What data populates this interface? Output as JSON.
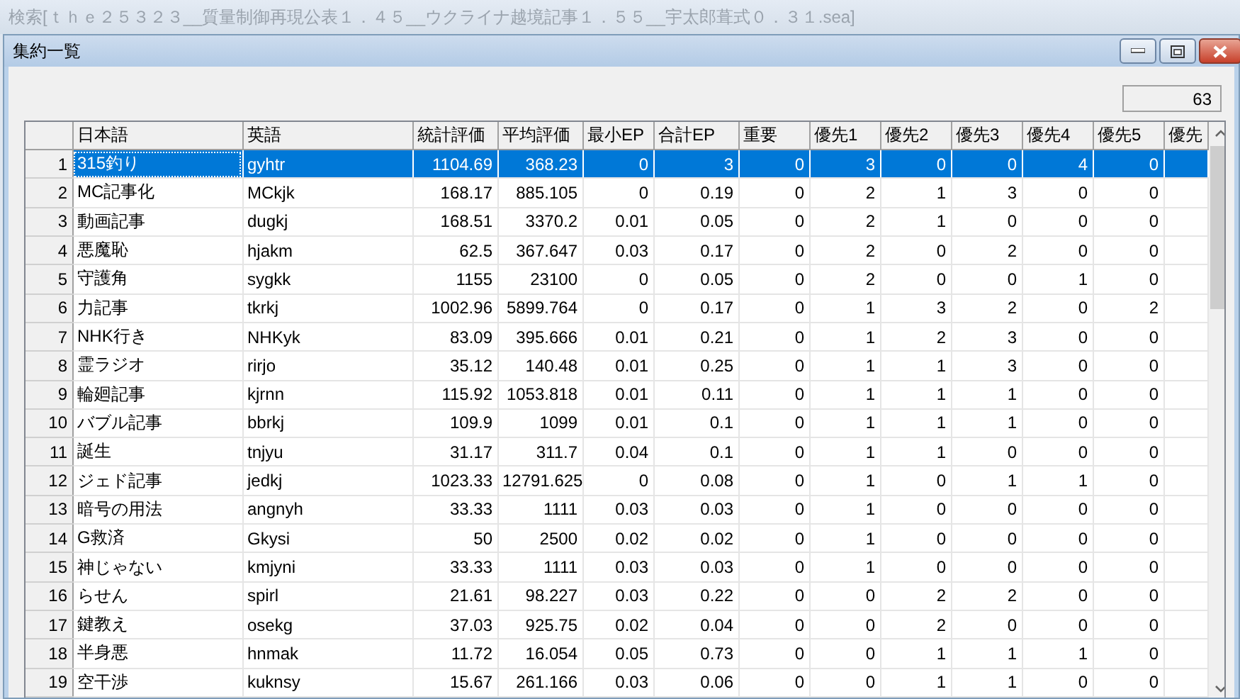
{
  "outer_window": {
    "title": "検索[ｔｈｅ２５３２３__質量制御再現公表１．４５__ウクライナ越境記事１．５５__宇太郎葺式０．３１.sea]"
  },
  "window": {
    "title": "集約一覧"
  },
  "count": "63",
  "table": {
    "columns": [
      "日本語",
      "英語",
      "統計評価",
      "平均評価",
      "最小EP",
      "合計EP",
      "重要",
      "優先1",
      "優先2",
      "優先3",
      "優先4",
      "優先5",
      "優先"
    ],
    "rows": [
      {
        "number": "1",
        "selected": true,
        "cells": [
          "315釣り",
          "gyhtr",
          "1104.69",
          "368.23",
          "0",
          "3",
          "0",
          "3",
          "0",
          "0",
          "4",
          "0"
        ]
      },
      {
        "number": "2",
        "selected": false,
        "cells": [
          "MC記事化",
          "MCkjk",
          "168.17",
          "885.105",
          "0",
          "0.19",
          "0",
          "2",
          "1",
          "3",
          "0",
          "0"
        ]
      },
      {
        "number": "3",
        "selected": false,
        "cells": [
          "動画記事",
          "dugkj",
          "168.51",
          "3370.2",
          "0.01",
          "0.05",
          "0",
          "2",
          "1",
          "0",
          "0",
          "0"
        ]
      },
      {
        "number": "4",
        "selected": false,
        "cells": [
          "悪魔恥",
          "hjakm",
          "62.5",
          "367.647",
          "0.03",
          "0.17",
          "0",
          "2",
          "0",
          "2",
          "0",
          "0"
        ]
      },
      {
        "number": "5",
        "selected": false,
        "cells": [
          "守護角",
          "sygkk",
          "1155",
          "23100",
          "0",
          "0.05",
          "0",
          "2",
          "0",
          "0",
          "1",
          "0"
        ]
      },
      {
        "number": "6",
        "selected": false,
        "cells": [
          "力記事",
          "tkrkj",
          "1002.96",
          "5899.764",
          "0",
          "0.17",
          "0",
          "1",
          "3",
          "2",
          "0",
          "2"
        ]
      },
      {
        "number": "7",
        "selected": false,
        "cells": [
          "NHK行き",
          "NHKyk",
          "83.09",
          "395.666",
          "0.01",
          "0.21",
          "0",
          "1",
          "2",
          "3",
          "0",
          "0"
        ]
      },
      {
        "number": "8",
        "selected": false,
        "cells": [
          "霊ラジオ",
          "rirjo",
          "35.12",
          "140.48",
          "0.01",
          "0.25",
          "0",
          "1",
          "1",
          "3",
          "0",
          "0"
        ]
      },
      {
        "number": "9",
        "selected": false,
        "cells": [
          "輪廻記事",
          "kjrnn",
          "115.92",
          "1053.818",
          "0.01",
          "0.11",
          "0",
          "1",
          "1",
          "1",
          "0",
          "0"
        ]
      },
      {
        "number": "10",
        "selected": false,
        "cells": [
          "バブル記事",
          "bbrkj",
          "109.9",
          "1099",
          "0.01",
          "0.1",
          "0",
          "1",
          "1",
          "1",
          "0",
          "0"
        ]
      },
      {
        "number": "11",
        "selected": false,
        "cells": [
          "誕生",
          "tnjyu",
          "31.17",
          "311.7",
          "0.04",
          "0.1",
          "0",
          "1",
          "1",
          "0",
          "0",
          "0"
        ]
      },
      {
        "number": "12",
        "selected": false,
        "cells": [
          "ジェド記事",
          "jedkj",
          "1023.33",
          "12791.625",
          "0",
          "0.08",
          "0",
          "1",
          "0",
          "1",
          "1",
          "0"
        ]
      },
      {
        "number": "13",
        "selected": false,
        "cells": [
          "暗号の用法",
          "angnyh",
          "33.33",
          "1111",
          "0.03",
          "0.03",
          "0",
          "1",
          "0",
          "0",
          "0",
          "0"
        ]
      },
      {
        "number": "14",
        "selected": false,
        "cells": [
          "G救済",
          "Gkysi",
          "50",
          "2500",
          "0.02",
          "0.02",
          "0",
          "1",
          "0",
          "0",
          "0",
          "0"
        ]
      },
      {
        "number": "15",
        "selected": false,
        "cells": [
          "神じゃない",
          "kmjyni",
          "33.33",
          "1111",
          "0.03",
          "0.03",
          "0",
          "1",
          "0",
          "0",
          "0",
          "0"
        ]
      },
      {
        "number": "16",
        "selected": false,
        "cells": [
          "らせん",
          "spirl",
          "21.61",
          "98.227",
          "0.03",
          "0.22",
          "0",
          "0",
          "2",
          "2",
          "0",
          "0"
        ]
      },
      {
        "number": "17",
        "selected": false,
        "cells": [
          "鍵教え",
          "osekg",
          "37.03",
          "925.75",
          "0.02",
          "0.04",
          "0",
          "0",
          "2",
          "0",
          "0",
          "0"
        ]
      },
      {
        "number": "18",
        "selected": false,
        "cells": [
          "半身悪",
          "hnmak",
          "11.72",
          "16.054",
          "0.05",
          "0.73",
          "0",
          "0",
          "1",
          "1",
          "1",
          "0"
        ]
      },
      {
        "number": "19",
        "selected": false,
        "cells": [
          "空干渉",
          "kuknsy",
          "15.67",
          "261.166",
          "0.03",
          "0.06",
          "0",
          "0",
          "1",
          "1",
          "0",
          "0"
        ]
      }
    ]
  }
}
